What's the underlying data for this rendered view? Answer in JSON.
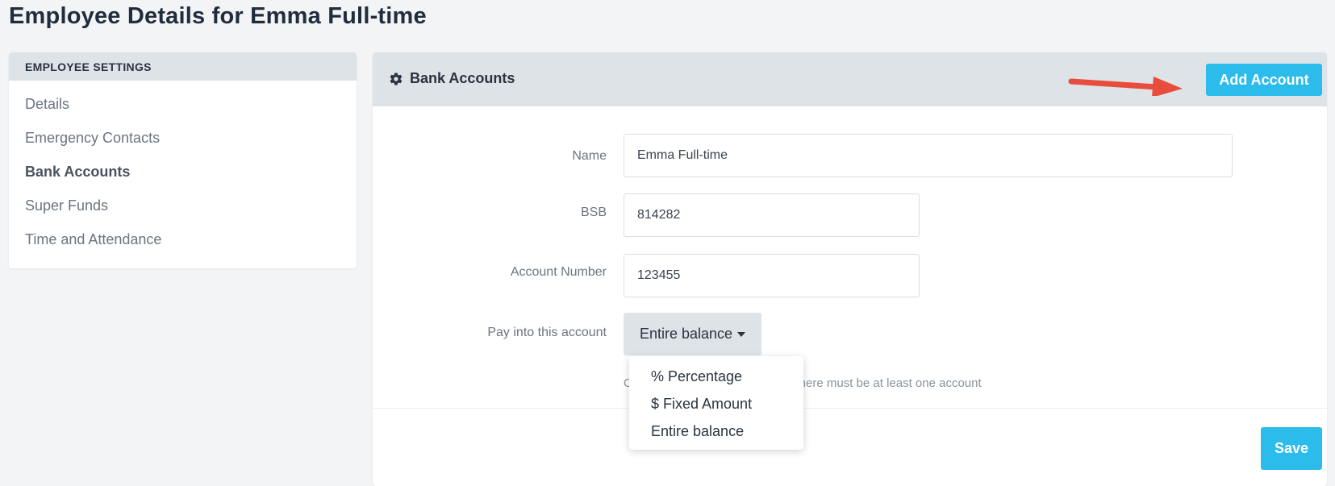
{
  "page": {
    "title": "Employee Details for Emma Full-time"
  },
  "sidebar": {
    "header": "EMPLOYEE SETTINGS",
    "items": [
      {
        "label": "Details"
      },
      {
        "label": "Emergency Contacts"
      },
      {
        "label": "Bank Accounts"
      },
      {
        "label": "Super Funds"
      },
      {
        "label": "Time and Attendance"
      }
    ],
    "active_index": 2
  },
  "panel": {
    "title": "Bank Accounts",
    "title_icon": "gear-icon",
    "add_account_label": "Add Account",
    "annotation_arrow_color": "#e74c3c"
  },
  "form": {
    "name_label": "Name",
    "name_value": "Emma Full-time",
    "bsb_label": "BSB",
    "bsb_value": "814282",
    "account_number_label": "Account Number",
    "account_number_value": "123455",
    "pay_into_label": "Pay into this account",
    "pay_into_selected": "Entire balance",
    "pay_into_options": [
      "% Percentage",
      "$ Fixed Amount",
      "Entire balance"
    ],
    "help_text_visible_start": "O",
    "help_text_visible_end": "here must be at least one account"
  },
  "actions": {
    "save_label": "Save"
  },
  "colors": {
    "accent": "#2bbcec",
    "header_bg": "#dde3e7",
    "page_bg": "#f3f4f6"
  }
}
